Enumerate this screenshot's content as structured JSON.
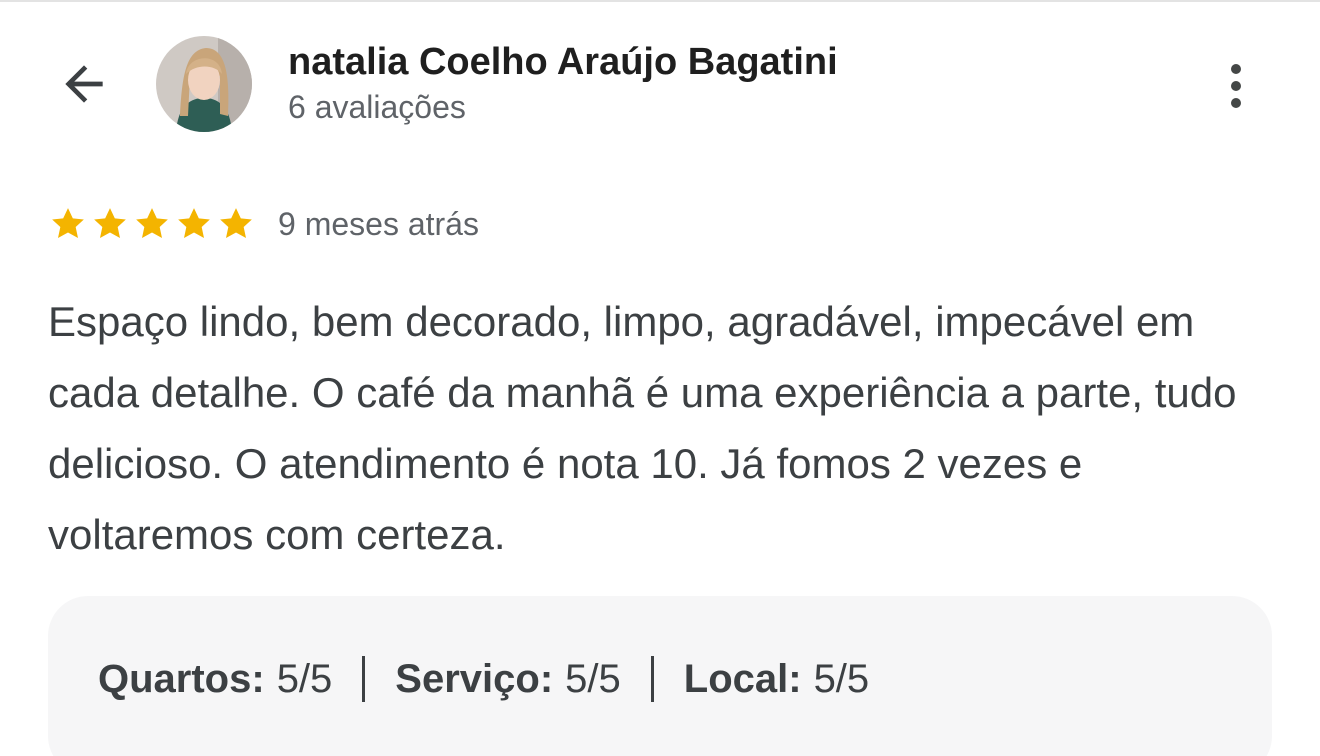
{
  "reviewer": {
    "name": "natalia Coelho Araújo Bagatini",
    "review_count": "6 avaliações"
  },
  "review": {
    "stars": 5,
    "max_stars": 5,
    "date": "9 meses atrás",
    "text": "Espaço lindo, bem decorado, limpo, agradável, impecável em cada detalhe. O café da manhã é uma experiência a parte, tudo delicioso. O atendimento é nota 10. Já fomos 2 vezes e voltaremos com certeza."
  },
  "sub_ratings": [
    {
      "label": "Quartos:",
      "value": "5/5"
    },
    {
      "label": "Serviço:",
      "value": "5/5"
    },
    {
      "label": "Local:",
      "value": "5/5"
    }
  ],
  "icons": {
    "back": "arrow-back-icon",
    "more": "more-vert-icon",
    "star": "star-icon"
  },
  "colors": {
    "star": "#f4b400",
    "text_primary": "#1f1f1f",
    "text_secondary": "#5f6368",
    "ratings_bg": "#f6f6f7"
  }
}
